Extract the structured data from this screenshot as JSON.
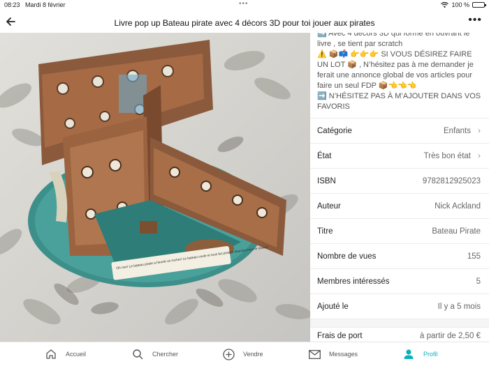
{
  "status_bar": {
    "time": "08:23",
    "date": "Mardi 8 février",
    "battery": "100 %",
    "battery_level": 1.0
  },
  "header": {
    "title": "Livre pop up Bateau pirate avec 4 décors 3D pour toi jouer aux pirates"
  },
  "description": [
    "➡️ Avec 4 décors 3D qui forme en ouvrant le livre , se tient par scratch",
    "⚠️ 📦📫 👉👉👉 SI VOUS DÉSIREZ FAIRE UN LOT 📦 , N’hésitez pas à me demander je ferait une annonce global de vos articles pour faire un seul FDP 📦👈👈👈",
    "➡️ N’HÉSITEZ PAS À M’AJOUTER DANS VOS FAVORIS"
  ],
  "details": [
    {
      "label": "Catégorie",
      "value": "Enfants",
      "link": true
    },
    {
      "label": "État",
      "value": "Très bon état",
      "link": true
    },
    {
      "label": "ISBN",
      "value": "9782812925023",
      "link": false
    },
    {
      "label": "Auteur",
      "value": "Nick Ackland",
      "link": false
    },
    {
      "label": "Titre",
      "value": "Bateau Pirate",
      "link": false
    },
    {
      "label": "Nombre de vues",
      "value": "155",
      "link": false
    },
    {
      "label": "Membres intéressés",
      "value": "5",
      "link": false
    },
    {
      "label": "Ajouté le",
      "value": "Il y a 5 mois",
      "link": false
    }
  ],
  "shipping": {
    "label": "Frais de port",
    "value": "à partir de 2,50 €"
  },
  "nav": [
    {
      "label": "Accueil",
      "icon": "home-icon"
    },
    {
      "label": "Chercher",
      "icon": "search-icon"
    },
    {
      "label": "Vendre",
      "icon": "plus-circle-icon"
    },
    {
      "label": "Messages",
      "icon": "mail-icon"
    },
    {
      "label": "Profil",
      "icon": "profile-icon"
    }
  ],
  "book_caption": "Oh non! Le bateau pirate a heurté un rocher! Le bateau coule et tous les pirates abandonnent le navire!",
  "colors": {
    "accent": "#09b1ba"
  },
  "photo_pages": 3,
  "photo_active_page": 1
}
